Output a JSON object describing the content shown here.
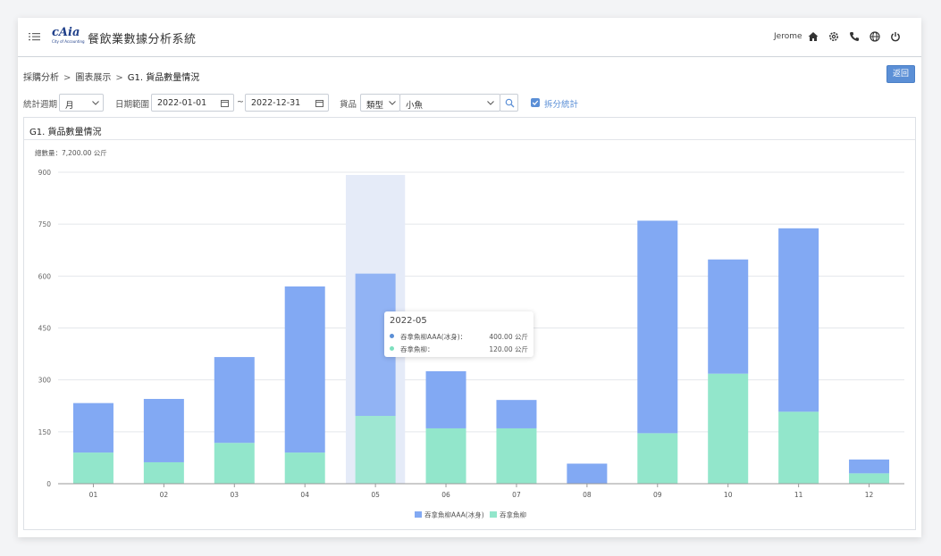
{
  "header": {
    "logo_main": "cAia",
    "logo_sub": "City of Accounting",
    "app_title": "餐飲業數據分析系統",
    "user": "Jerome",
    "icons": [
      "home-icon",
      "gear-icon",
      "phone-icon",
      "globe-icon",
      "power-icon"
    ]
  },
  "breadcrumb": {
    "items": [
      "採購分析",
      "圖表展示",
      "G1. 貨品數量情況"
    ],
    "separator": ">"
  },
  "back_button": "返回",
  "filters": {
    "period_label": "統計週期",
    "period_value": "月",
    "date_label": "日期範圍",
    "date_from": "2022-01-01",
    "date_to": "2022-12-31",
    "date_sep": "~",
    "goods_label": "貨品",
    "goods_type": "類型",
    "goods_value": "小魚",
    "split_label": "拆分統計"
  },
  "panel": {
    "title": "G1. 貨品數量情況",
    "total": "總數量：7,200.00 公斤"
  },
  "tooltip": {
    "title": "2022-05",
    "rows": [
      {
        "name": "吞拿魚柳AAA(冰身)：",
        "value": "400.00 公斤"
      },
      {
        "name": "吞拿魚柳：",
        "value": "120.00 公斤"
      }
    ]
  },
  "colors": {
    "series_a": "#82a9f3",
    "series_b": "#92e6cb",
    "accent": "#5b8fd6",
    "highlight": "#e5ebf8"
  },
  "chart_data": {
    "type": "bar",
    "stacked": true,
    "categories": [
      "01",
      "02",
      "03",
      "04",
      "05",
      "06",
      "07",
      "08",
      "09",
      "10",
      "11",
      "12"
    ],
    "series": [
      {
        "name": "吞拿魚柳",
        "values": [
          90,
          62,
          118,
          90,
          196,
          160,
          160,
          0,
          146,
          318,
          208,
          30
        ]
      },
      {
        "name": "吞拿魚柳AAA(冰身)",
        "values": [
          143,
          183,
          248,
          480,
          411,
          165,
          82,
          58,
          614,
          330,
          530,
          40
        ]
      }
    ],
    "legend": [
      "吞拿魚柳AAA(冰身)",
      "吞拿魚柳"
    ],
    "yticks": [
      "0",
      "150",
      "300",
      "450",
      "600",
      "750",
      "900"
    ],
    "ylim": [
      0,
      900
    ],
    "grid": true,
    "legend_position": "bottom",
    "highlighted_category": "05"
  }
}
